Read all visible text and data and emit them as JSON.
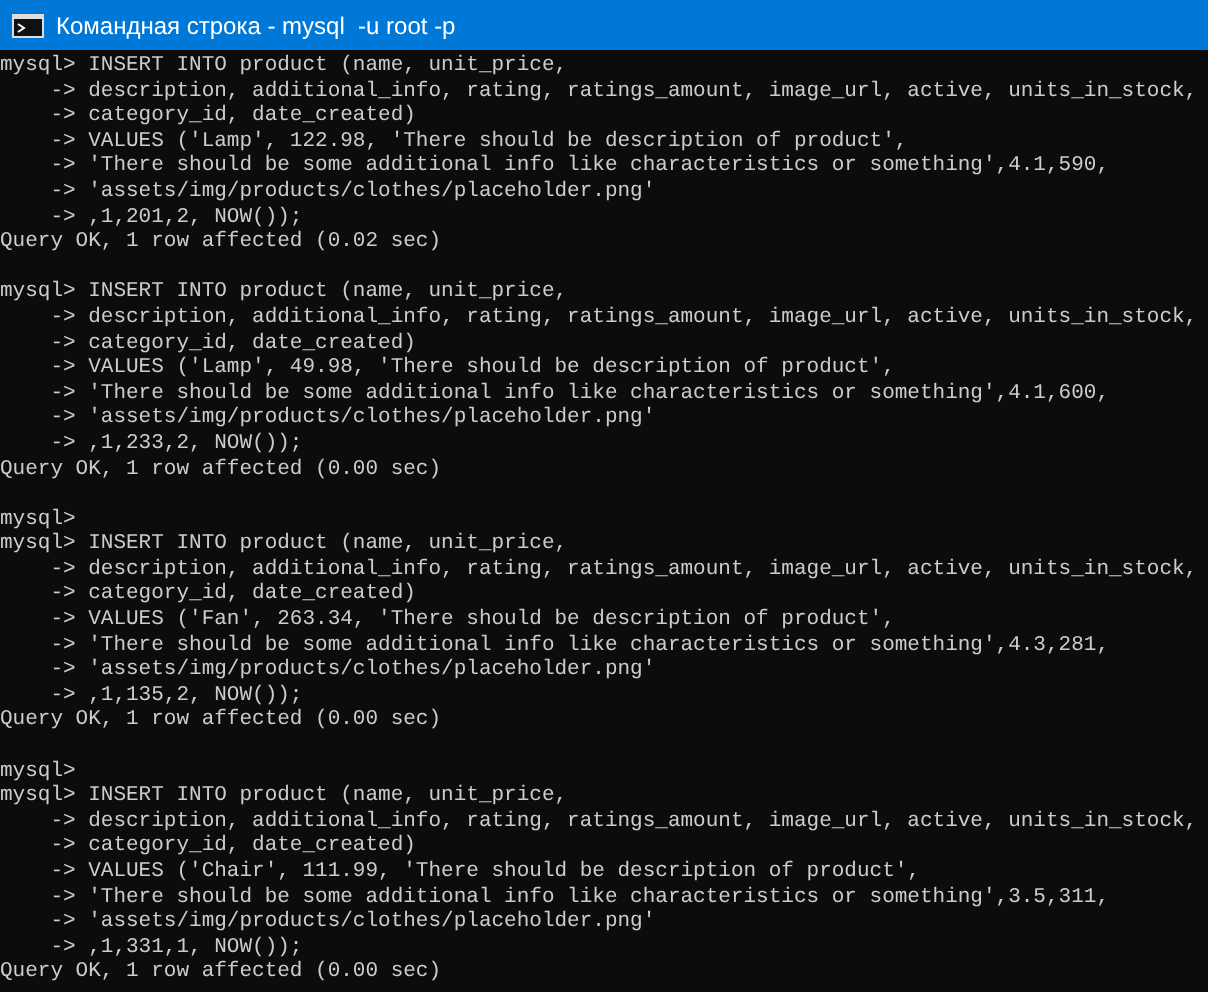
{
  "window": {
    "title": "Командная строка - mysql  -u root -p"
  },
  "console": {
    "blocks": [
      {
        "lines": [
          "mysql> INSERT INTO product (name, unit_price,",
          "    -> description, additional_info, rating, ratings_amount, image_url, active, units_in_stock,",
          "    -> category_id, date_created)",
          "    -> VALUES ('Lamp', 122.98, 'There should be description of product',",
          "    -> 'There should be some additional info like characteristics or something',4.1,590,",
          "    -> 'assets/img/products/clothes/placeholder.png'",
          "    -> ,1,201,2, NOW());",
          "Query OK, 1 row affected (0.02 sec)"
        ]
      },
      {
        "lines": [
          "mysql> INSERT INTO product (name, unit_price,",
          "    -> description, additional_info, rating, ratings_amount, image_url, active, units_in_stock,",
          "    -> category_id, date_created)",
          "    -> VALUES ('Lamp', 49.98, 'There should be description of product',",
          "    -> 'There should be some additional info like characteristics or something',4.1,600,",
          "    -> 'assets/img/products/clothes/placeholder.png'",
          "    -> ,1,233,2, NOW());",
          "Query OK, 1 row affected (0.00 sec)"
        ]
      },
      {
        "lines": [
          "mysql>",
          "mysql> INSERT INTO product (name, unit_price,",
          "    -> description, additional_info, rating, ratings_amount, image_url, active, units_in_stock,",
          "    -> category_id, date_created)",
          "    -> VALUES ('Fan', 263.34, 'There should be description of product',",
          "    -> 'There should be some additional info like characteristics or something',4.3,281,",
          "    -> 'assets/img/products/clothes/placeholder.png'",
          "    -> ,1,135,2, NOW());",
          "Query OK, 1 row affected (0.00 sec)"
        ]
      },
      {
        "lines": [
          "mysql>",
          "mysql> INSERT INTO product (name, unit_price,",
          "    -> description, additional_info, rating, ratings_amount, image_url, active, units_in_stock,",
          "    -> category_id, date_created)",
          "    -> VALUES ('Chair', 111.99, 'There should be description of product',",
          "    -> 'There should be some additional info like characteristics or something',3.5,311,",
          "    -> 'assets/img/products/clothes/placeholder.png'",
          "    -> ,1,331,1, NOW());",
          "Query OK, 1 row affected (0.00 sec)"
        ]
      }
    ]
  }
}
